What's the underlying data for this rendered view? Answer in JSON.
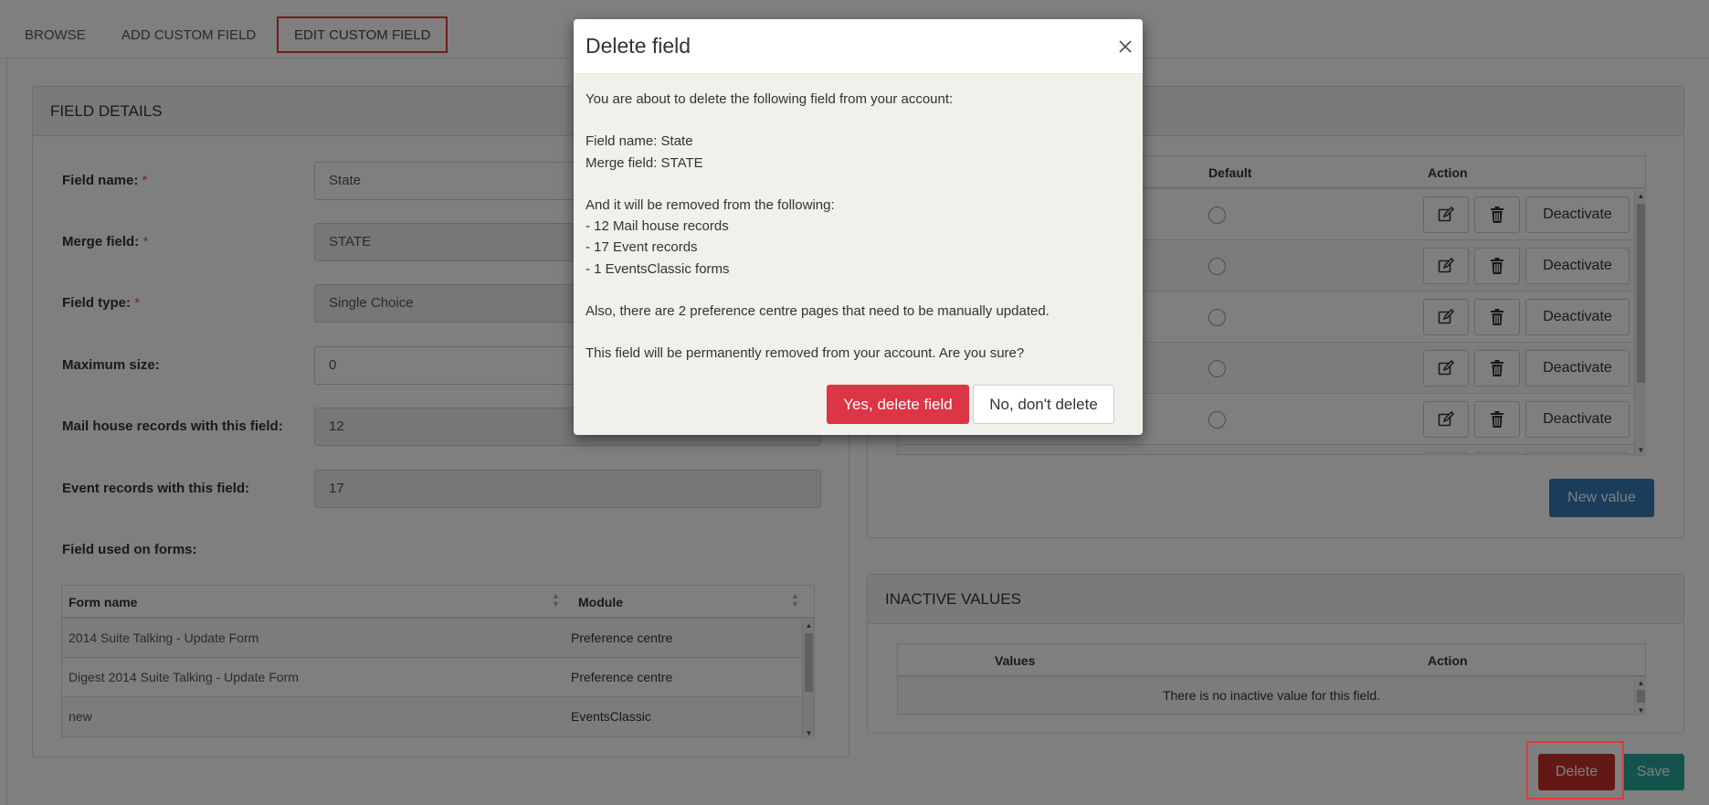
{
  "tabs": {
    "browse": "BROWSE",
    "add": "ADD CUSTOM FIELD",
    "edit": "EDIT CUSTOM FIELD"
  },
  "field_details": {
    "title": "FIELD DETAILS",
    "rows": [
      {
        "label": "Field name:",
        "required": "*",
        "value": "State",
        "readonly": false
      },
      {
        "label": "Merge field:",
        "required": "*",
        "value": "STATE",
        "readonly": true
      },
      {
        "label": "Field type:",
        "required": "*",
        "value": "Single Choice",
        "readonly": true
      },
      {
        "label": "Maximum size:",
        "required": "",
        "value": "0",
        "readonly": false
      },
      {
        "label": "Mail house records with this field:",
        "required": "",
        "value": "12",
        "readonly": true
      },
      {
        "label": "Event records with this field:",
        "required": "",
        "value": "17",
        "readonly": true
      }
    ],
    "forms_label": "Field used on forms:",
    "forms_table": {
      "headers": [
        "Form name",
        "Module"
      ],
      "rows": [
        [
          "2014 Suite Talking - Update Form",
          "Preference centre"
        ],
        [
          "Digest 2014 Suite Talking - Update Form",
          "Preference centre"
        ],
        [
          "new",
          "EventsClassic"
        ]
      ]
    }
  },
  "values": {
    "headers": {
      "default": "Default",
      "action": "Action"
    },
    "deactivate_label": "Deactivate",
    "row_count": 5,
    "new_value_label": "New value"
  },
  "inactive": {
    "title": "INACTIVE VALUES",
    "headers": {
      "values": "Values",
      "action": "Action"
    },
    "empty_text": "There is no inactive value for this field."
  },
  "footer": {
    "delete_label": "Delete",
    "save_label": "Save"
  },
  "modal": {
    "title": "Delete field",
    "intro": "You are about to delete the following field from your account:",
    "field_name": "Field name: State",
    "merge_field": "Merge field: STATE",
    "removed_from": "And it will be removed from the following:",
    "items": [
      "- 12 Mail house records",
      "- 17 Event records",
      "- 1 EventsClassic forms"
    ],
    "preference_note": "Also, there are 2 preference centre pages that need to be manually updated.",
    "confirm_text": "This field will be permanently removed from your account. Are you sure?",
    "yes_label": "Yes, delete field",
    "no_label": "No, don't delete"
  },
  "colors": {
    "danger": "#dc3545",
    "primary": "#337ab7",
    "save": "#26a69a",
    "highlight": "#e03a3a"
  }
}
